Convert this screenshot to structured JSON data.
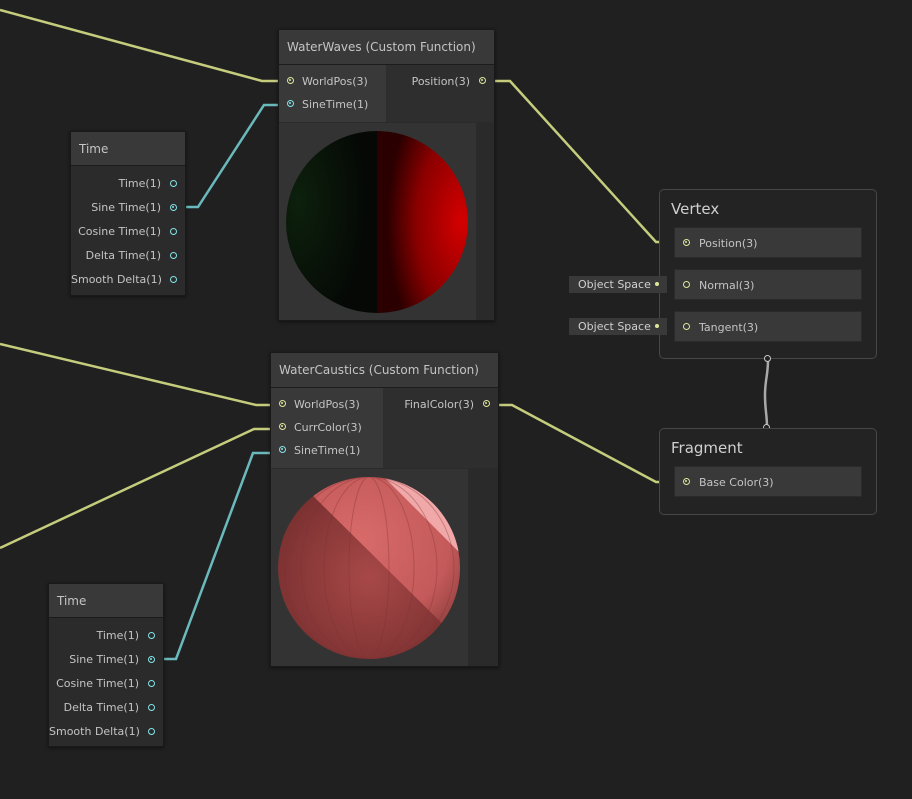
{
  "water_waves": {
    "title": "WaterWaves (Custom Function)",
    "inputs": [
      "WorldPos(3)",
      "SineTime(1)"
    ],
    "outputs": [
      "Position(3)"
    ]
  },
  "water_caustics": {
    "title": "WaterCaustics (Custom Function)",
    "inputs": [
      "WorldPos(3)",
      "CurrColor(3)",
      "SineTime(1)"
    ],
    "outputs": [
      "FinalColor(3)"
    ]
  },
  "time_node_1": {
    "title": "Time",
    "outputs": [
      "Time(1)",
      "Sine Time(1)",
      "Cosine Time(1)",
      "Delta Time(1)",
      "Smooth Delta(1)"
    ]
  },
  "time_node_2": {
    "title": "Time",
    "outputs": [
      "Time(1)",
      "Sine Time(1)",
      "Cosine Time(1)",
      "Delta Time(1)",
      "Smooth Delta(1)"
    ]
  },
  "vertex": {
    "title": "Vertex",
    "slots": [
      "Position(3)",
      "Normal(3)",
      "Tangent(3)"
    ],
    "space_labels": [
      "Object Space",
      "Object Space"
    ]
  },
  "fragment": {
    "title": "Fragment",
    "slots": [
      "Base Color(3)"
    ]
  },
  "colors": {
    "background": "#202020",
    "vector3_wire": "#c5cd7d",
    "float_wire": "#6ab9bc",
    "node_header": "#393939",
    "port_vec3": "#dfe69b",
    "port_float": "#84e4e7"
  }
}
